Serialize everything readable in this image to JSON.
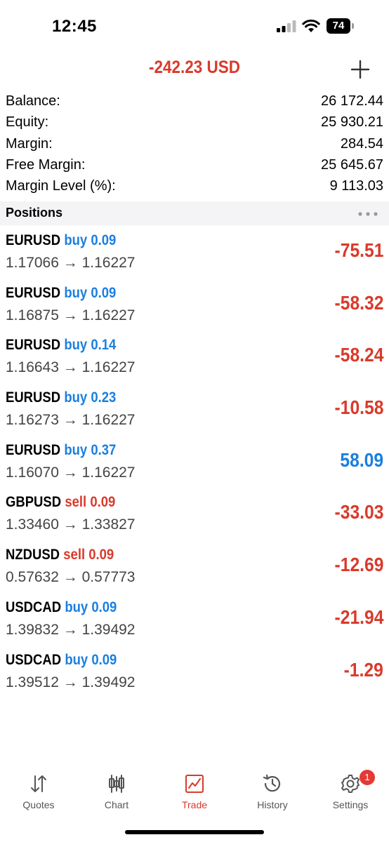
{
  "status_bar": {
    "time": "12:45",
    "battery": "74"
  },
  "header": {
    "total_profit": "-242.23 USD",
    "profit_color": "#d93a2b"
  },
  "summary": [
    {
      "label": "Balance:",
      "value": "26 172.44"
    },
    {
      "label": "Equity:",
      "value": "25 930.21"
    },
    {
      "label": "Margin:",
      "value": "284.54"
    },
    {
      "label": "Free Margin:",
      "value": "25 645.67"
    },
    {
      "label": "Margin Level (%):",
      "value": "9 113.03"
    }
  ],
  "positions_section": {
    "title": "Positions"
  },
  "colors": {
    "buy": "#1a7fe0",
    "sell": "#d93a2b",
    "loss": "#d93a2b",
    "gain": "#1a7fe0",
    "active_tab": "#d93a2b",
    "inactive_tab": "#555555"
  },
  "positions": [
    {
      "symbol": "EURUSD",
      "side": "buy 0.09",
      "type": "buy",
      "prices": "1.17066 → 1.16227",
      "profit": "-75.51"
    },
    {
      "symbol": "EURUSD",
      "side": "buy 0.09",
      "type": "buy",
      "prices": "1.16875 → 1.16227",
      "profit": "-58.32"
    },
    {
      "symbol": "EURUSD",
      "side": "buy 0.14",
      "type": "buy",
      "prices": "1.16643 → 1.16227",
      "profit": "-58.24"
    },
    {
      "symbol": "EURUSD",
      "side": "buy 0.23",
      "type": "buy",
      "prices": "1.16273 → 1.16227",
      "profit": "-10.58"
    },
    {
      "symbol": "EURUSD",
      "side": "buy 0.37",
      "type": "buy",
      "prices": "1.16070 → 1.16227",
      "profit": "58.09"
    },
    {
      "symbol": "GBPUSD",
      "side": "sell 0.09",
      "type": "sell",
      "prices": "1.33460 → 1.33827",
      "profit": "-33.03"
    },
    {
      "symbol": "NZDUSD",
      "side": "sell 0.09",
      "type": "sell",
      "prices": "0.57632 → 0.57773",
      "profit": "-12.69"
    },
    {
      "symbol": "USDCAD",
      "side": "buy 0.09",
      "type": "buy",
      "prices": "1.39832 → 1.39492",
      "profit": "-21.94"
    },
    {
      "symbol": "USDCAD",
      "side": "buy 0.09",
      "type": "buy",
      "prices": "1.39512 → 1.39492",
      "profit": "-1.29"
    }
  ],
  "tabs": [
    {
      "label": "Quotes",
      "icon": "quotes-icon",
      "active": false
    },
    {
      "label": "Chart",
      "icon": "chart-icon",
      "active": false
    },
    {
      "label": "Trade",
      "icon": "trade-icon",
      "active": true
    },
    {
      "label": "History",
      "icon": "history-icon",
      "active": false
    },
    {
      "label": "Settings",
      "icon": "gear-icon",
      "active": false,
      "badge": "1"
    }
  ]
}
